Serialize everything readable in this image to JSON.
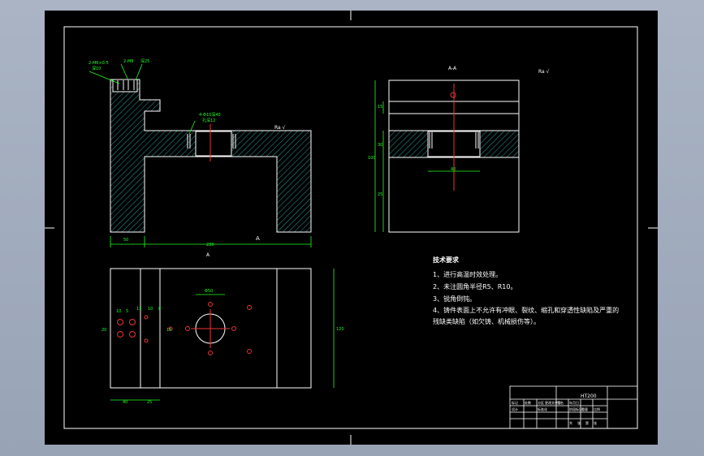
{
  "drawing": {
    "section_label": "A-A",
    "roughness_note": "Ra √",
    "view_arrow_label": "A",
    "bottom_arrow_label": "A"
  },
  "front_view": {
    "note_1": "2-M6×0.5",
    "note_2": "深10",
    "note_3": "2-M8",
    "note_4": "深25",
    "note_5": "4-Φ10",
    "hole_note_1": "4-Φ10深40",
    "hole_note_2": "孔深12",
    "dim_bottom_left": "50",
    "dim_bottom_total": "230"
  },
  "side_view": {
    "dim_top": "15",
    "dim_mid": "30",
    "dim_total": "100",
    "dim_lower": "25",
    "dim_hole": "40"
  },
  "top_view": {
    "dim_bore": "Φ50",
    "dim_height": "120",
    "dim_left": "40",
    "dim_left2": "25",
    "small_dims": [
      "10",
      "5",
      "13",
      "10",
      "8"
    ],
    "side_dims": [
      "20",
      "15"
    ]
  },
  "tech_requirements": {
    "title": "技术要求",
    "items": [
      "1、进行高温时效处理。",
      "2、未注圆角半径R5、R10。",
      "3、锐角倒钝。",
      "4、铸件表面上不允许有冲眼、裂纹、缩孔和穿透性缺陷及严重的",
      "残缺类缺陷（如欠铸、机械损伤等）。"
    ]
  },
  "title_block": {
    "material": "HT200",
    "labels": [
      "标记",
      "处数",
      "分区",
      "更改文件号",
      "签名",
      "年月日"
    ],
    "row2": [
      "设计",
      "标准化"
    ],
    "stage": [
      "阶段标记",
      "重量",
      "比例"
    ],
    "scale_row": [
      "共",
      "张",
      "第",
      "张"
    ]
  }
}
